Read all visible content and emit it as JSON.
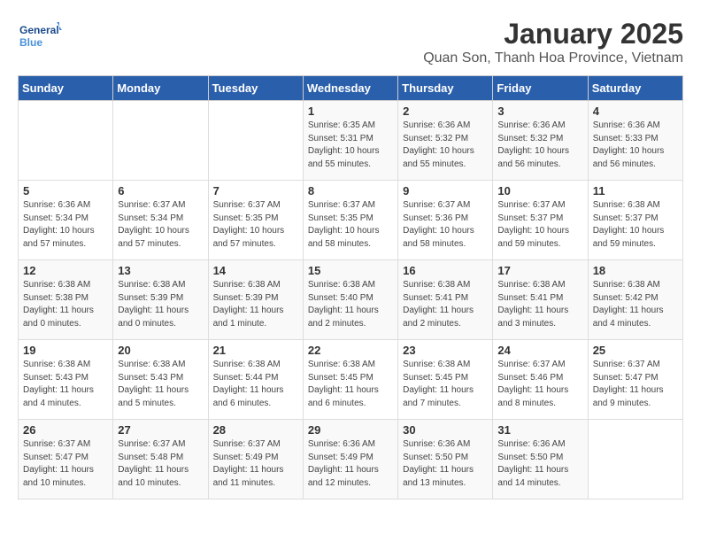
{
  "logo": {
    "line1": "General",
    "line2": "Blue"
  },
  "title": "January 2025",
  "subtitle": "Quan Son, Thanh Hoa Province, Vietnam",
  "days_of_week": [
    "Sunday",
    "Monday",
    "Tuesday",
    "Wednesday",
    "Thursday",
    "Friday",
    "Saturday"
  ],
  "weeks": [
    [
      {
        "day": "",
        "content": ""
      },
      {
        "day": "",
        "content": ""
      },
      {
        "day": "",
        "content": ""
      },
      {
        "day": "1",
        "content": "Sunrise: 6:35 AM\nSunset: 5:31 PM\nDaylight: 10 hours\nand 55 minutes."
      },
      {
        "day": "2",
        "content": "Sunrise: 6:36 AM\nSunset: 5:32 PM\nDaylight: 10 hours\nand 55 minutes."
      },
      {
        "day": "3",
        "content": "Sunrise: 6:36 AM\nSunset: 5:32 PM\nDaylight: 10 hours\nand 56 minutes."
      },
      {
        "day": "4",
        "content": "Sunrise: 6:36 AM\nSunset: 5:33 PM\nDaylight: 10 hours\nand 56 minutes."
      }
    ],
    [
      {
        "day": "5",
        "content": "Sunrise: 6:36 AM\nSunset: 5:34 PM\nDaylight: 10 hours\nand 57 minutes."
      },
      {
        "day": "6",
        "content": "Sunrise: 6:37 AM\nSunset: 5:34 PM\nDaylight: 10 hours\nand 57 minutes."
      },
      {
        "day": "7",
        "content": "Sunrise: 6:37 AM\nSunset: 5:35 PM\nDaylight: 10 hours\nand 57 minutes."
      },
      {
        "day": "8",
        "content": "Sunrise: 6:37 AM\nSunset: 5:35 PM\nDaylight: 10 hours\nand 58 minutes."
      },
      {
        "day": "9",
        "content": "Sunrise: 6:37 AM\nSunset: 5:36 PM\nDaylight: 10 hours\nand 58 minutes."
      },
      {
        "day": "10",
        "content": "Sunrise: 6:37 AM\nSunset: 5:37 PM\nDaylight: 10 hours\nand 59 minutes."
      },
      {
        "day": "11",
        "content": "Sunrise: 6:38 AM\nSunset: 5:37 PM\nDaylight: 10 hours\nand 59 minutes."
      }
    ],
    [
      {
        "day": "12",
        "content": "Sunrise: 6:38 AM\nSunset: 5:38 PM\nDaylight: 11 hours\nand 0 minutes."
      },
      {
        "day": "13",
        "content": "Sunrise: 6:38 AM\nSunset: 5:39 PM\nDaylight: 11 hours\nand 0 minutes."
      },
      {
        "day": "14",
        "content": "Sunrise: 6:38 AM\nSunset: 5:39 PM\nDaylight: 11 hours\nand 1 minute."
      },
      {
        "day": "15",
        "content": "Sunrise: 6:38 AM\nSunset: 5:40 PM\nDaylight: 11 hours\nand 2 minutes."
      },
      {
        "day": "16",
        "content": "Sunrise: 6:38 AM\nSunset: 5:41 PM\nDaylight: 11 hours\nand 2 minutes."
      },
      {
        "day": "17",
        "content": "Sunrise: 6:38 AM\nSunset: 5:41 PM\nDaylight: 11 hours\nand 3 minutes."
      },
      {
        "day": "18",
        "content": "Sunrise: 6:38 AM\nSunset: 5:42 PM\nDaylight: 11 hours\nand 4 minutes."
      }
    ],
    [
      {
        "day": "19",
        "content": "Sunrise: 6:38 AM\nSunset: 5:43 PM\nDaylight: 11 hours\nand 4 minutes."
      },
      {
        "day": "20",
        "content": "Sunrise: 6:38 AM\nSunset: 5:43 PM\nDaylight: 11 hours\nand 5 minutes."
      },
      {
        "day": "21",
        "content": "Sunrise: 6:38 AM\nSunset: 5:44 PM\nDaylight: 11 hours\nand 6 minutes."
      },
      {
        "day": "22",
        "content": "Sunrise: 6:38 AM\nSunset: 5:45 PM\nDaylight: 11 hours\nand 6 minutes."
      },
      {
        "day": "23",
        "content": "Sunrise: 6:38 AM\nSunset: 5:45 PM\nDaylight: 11 hours\nand 7 minutes."
      },
      {
        "day": "24",
        "content": "Sunrise: 6:37 AM\nSunset: 5:46 PM\nDaylight: 11 hours\nand 8 minutes."
      },
      {
        "day": "25",
        "content": "Sunrise: 6:37 AM\nSunset: 5:47 PM\nDaylight: 11 hours\nand 9 minutes."
      }
    ],
    [
      {
        "day": "26",
        "content": "Sunrise: 6:37 AM\nSunset: 5:47 PM\nDaylight: 11 hours\nand 10 minutes."
      },
      {
        "day": "27",
        "content": "Sunrise: 6:37 AM\nSunset: 5:48 PM\nDaylight: 11 hours\nand 10 minutes."
      },
      {
        "day": "28",
        "content": "Sunrise: 6:37 AM\nSunset: 5:49 PM\nDaylight: 11 hours\nand 11 minutes."
      },
      {
        "day": "29",
        "content": "Sunrise: 6:36 AM\nSunset: 5:49 PM\nDaylight: 11 hours\nand 12 minutes."
      },
      {
        "day": "30",
        "content": "Sunrise: 6:36 AM\nSunset: 5:50 PM\nDaylight: 11 hours\nand 13 minutes."
      },
      {
        "day": "31",
        "content": "Sunrise: 6:36 AM\nSunset: 5:50 PM\nDaylight: 11 hours\nand 14 minutes."
      },
      {
        "day": "",
        "content": ""
      }
    ]
  ]
}
